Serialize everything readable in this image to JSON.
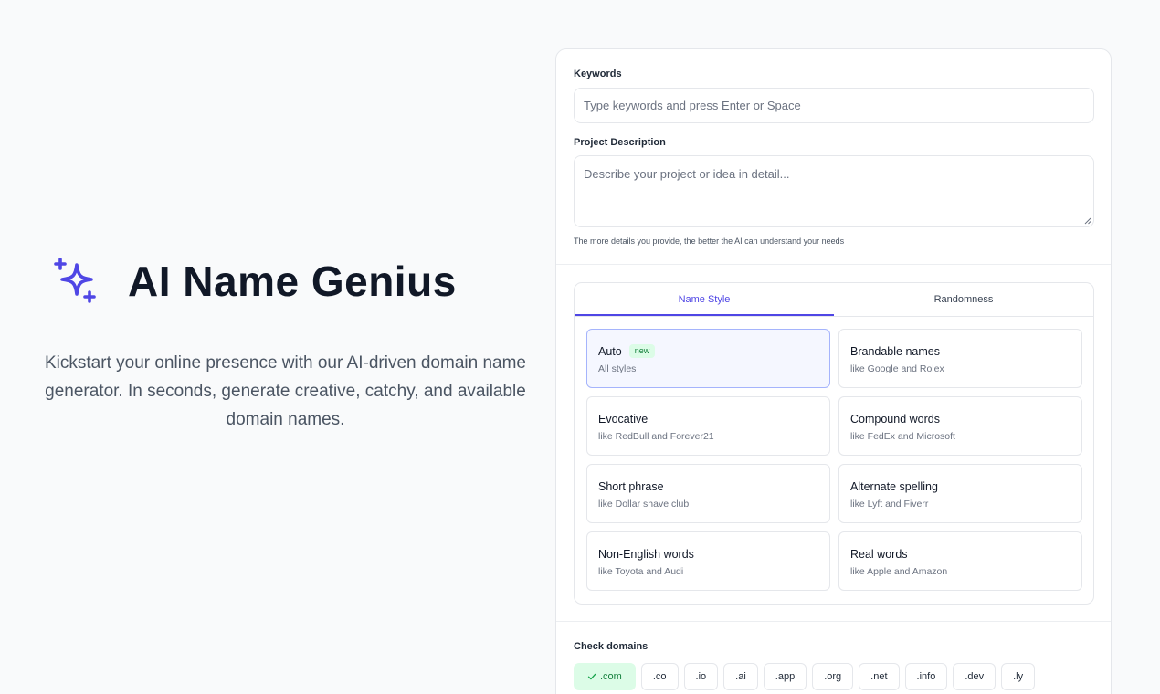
{
  "hero": {
    "title": "AI Name Genius",
    "tagline": "Kickstart your online presence with our AI-driven domain name generator. In seconds, generate creative, catchy, and available domain names.",
    "accent_color": "#4f46e5",
    "logo_icon": "sparkles-icon"
  },
  "form": {
    "keywords_label": "Keywords",
    "keywords_value": "",
    "keywords_placeholder": "Type keywords and press Enter or Space",
    "description_label": "Project Description",
    "description_value": "",
    "description_placeholder": "Describe your project or idea in detail...",
    "description_hint": "The more details you provide, the better the AI can understand your needs"
  },
  "tabs": [
    {
      "label": "Name Style",
      "active": true
    },
    {
      "label": "Randomness",
      "active": false
    }
  ],
  "name_styles": [
    {
      "title": "Auto",
      "badge": "new",
      "subtitle": "All styles",
      "selected": true
    },
    {
      "title": "Brandable names",
      "subtitle": "like Google and Rolex"
    },
    {
      "title": "Evocative",
      "subtitle": "like RedBull and Forever21"
    },
    {
      "title": "Compound words",
      "subtitle": "like FedEx and Microsoft"
    },
    {
      "title": "Short phrase",
      "subtitle": "like Dollar shave club"
    },
    {
      "title": "Alternate spelling",
      "subtitle": "like Lyft and Fiverr"
    },
    {
      "title": "Non-English words",
      "subtitle": "like Toyota and Audi"
    },
    {
      "title": "Real words",
      "subtitle": "like Apple and Amazon"
    }
  ],
  "check_domains": {
    "label": "Check domains",
    "tlds": [
      {
        "label": ".com",
        "active": true
      },
      {
        "label": ".co",
        "active": false
      },
      {
        "label": ".io",
        "active": false
      },
      {
        "label": ".ai",
        "active": false
      },
      {
        "label": ".app",
        "active": false
      },
      {
        "label": ".org",
        "active": false
      },
      {
        "label": ".net",
        "active": false
      },
      {
        "label": ".info",
        "active": false
      },
      {
        "label": ".dev",
        "active": false
      },
      {
        "label": ".ly",
        "active": false
      }
    ]
  }
}
